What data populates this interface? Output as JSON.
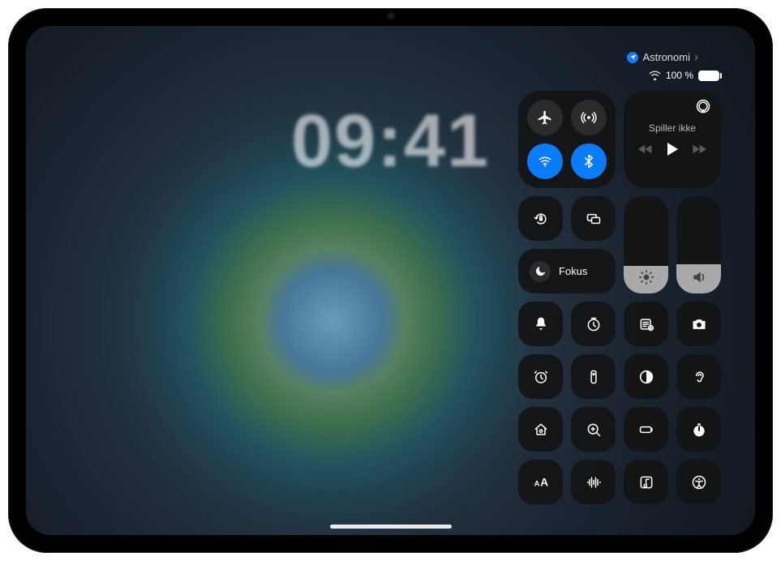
{
  "status": {
    "app_name": "Astronomi",
    "battery_text": "100 %"
  },
  "clock": {
    "time": "09:41"
  },
  "control_center": {
    "media": {
      "now_playing_label": "Spiller ikke"
    },
    "focus": {
      "label": "Fokus"
    },
    "brightness_level_percent": 28,
    "volume_level_percent": 30,
    "connectivity": {
      "airplane": false,
      "airdrop": false,
      "wifi": true,
      "bluetooth": true
    }
  }
}
